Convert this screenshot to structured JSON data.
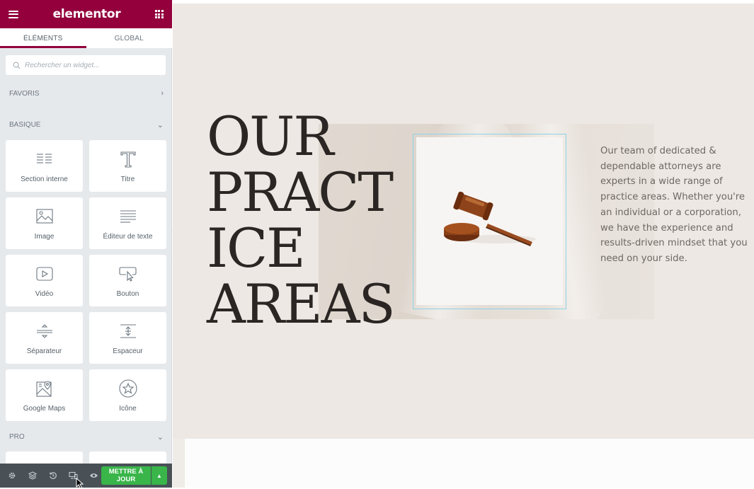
{
  "app": {
    "logo": "elementor",
    "brand_color": "#93003c",
    "update_color": "#39b54a"
  },
  "tabs": [
    {
      "label": "ÉLÉMENTS",
      "active": true
    },
    {
      "label": "GLOBAL",
      "active": false
    }
  ],
  "search": {
    "placeholder": "Rechercher un widget..."
  },
  "categories": {
    "favoris": "FAVORIS",
    "basique": "BASIQUE",
    "pro": "PRO"
  },
  "widgets": [
    {
      "label": "Section interne",
      "icon": "inner-section-icon"
    },
    {
      "label": "Titre",
      "icon": "heading-icon"
    },
    {
      "label": "Image",
      "icon": "image-icon"
    },
    {
      "label": "Éditeur de texte",
      "icon": "text-editor-icon"
    },
    {
      "label": "Vidéo",
      "icon": "video-icon"
    },
    {
      "label": "Bouton",
      "icon": "button-icon"
    },
    {
      "label": "Séparateur",
      "icon": "divider-icon"
    },
    {
      "label": "Espaceur",
      "icon": "spacer-icon"
    },
    {
      "label": "Google Maps",
      "icon": "google-maps-icon"
    },
    {
      "label": "Icône",
      "icon": "star-icon"
    }
  ],
  "footer": {
    "update_label_1": "METTRE À",
    "update_label_2": "JOUR"
  },
  "canvas": {
    "heading_lines": [
      "OUR",
      "PRACT",
      "ICE",
      "AREAS"
    ],
    "paragraph": "Our team of dedicated & dependable attorneys are experts in a wide range of practice areas. Whether you're an individual or a corporation, we have the experience and results-driven mindset that you need on your side."
  }
}
